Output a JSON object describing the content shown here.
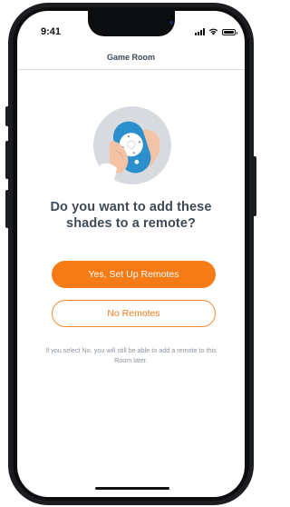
{
  "status_bar": {
    "time": "9:41",
    "icons": [
      "signal-icon",
      "wifi-icon",
      "battery-icon"
    ]
  },
  "header": {
    "title": "Game Room"
  },
  "illustration": {
    "icon": "hand-holding-remote-icon",
    "colors": {
      "circle": "#d7dbe0",
      "remote_body": "#2b8fce",
      "remote_face": "#ffffff",
      "hand": "#f4c3a6"
    }
  },
  "main": {
    "question": "Do you want to add these shades to a remote?",
    "primary_button_label": "Yes, Set Up Remotes",
    "secondary_button_label": "No Remotes",
    "footnote": "If you select No, you will still be able to add a remote to this Room later."
  },
  "colors": {
    "accent": "#f47b15",
    "text_dark": "#3e4a56",
    "text_muted": "#8b949c"
  }
}
